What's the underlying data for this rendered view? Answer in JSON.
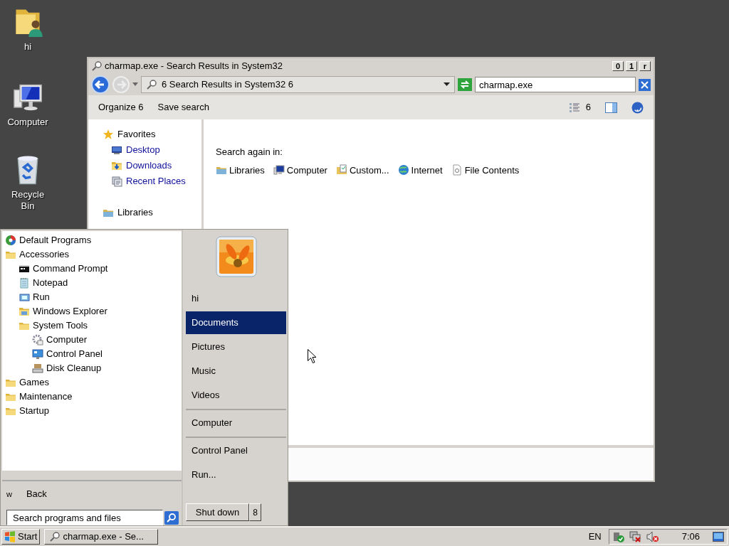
{
  "desktop_icons": [
    {
      "label": "hi",
      "kind": "user-folder"
    },
    {
      "label": "Computer",
      "kind": "computer"
    },
    {
      "label": "Recycle Bin",
      "kind": "recycle-bin"
    }
  ],
  "window": {
    "title": "charmap.exe - Search Results in System32",
    "title_buttons": [
      "0",
      "1",
      "r"
    ],
    "address": "6 Search Results in System32 6",
    "search_value": "charmap.exe",
    "toolbar": {
      "buttons": [
        "Organize 6",
        "Save search"
      ],
      "view_button": "6"
    },
    "nav": [
      {
        "label": "Favorites",
        "kind": "star",
        "children": [
          {
            "label": "Desktop",
            "kind": "desktop"
          },
          {
            "label": "Downloads",
            "kind": "downloads"
          },
          {
            "label": "Recent Places",
            "kind": "recent"
          }
        ]
      },
      {
        "label": "Libraries",
        "kind": "library"
      }
    ],
    "content": {
      "heading": "Search again in:",
      "locations": [
        {
          "label": "Libraries",
          "kind": "library"
        },
        {
          "label": "Computer",
          "kind": "computer"
        },
        {
          "label": "Custom...",
          "kind": "custom"
        },
        {
          "label": "Internet",
          "kind": "internet"
        },
        {
          "label": "File Contents",
          "kind": "file"
        }
      ]
    }
  },
  "start_menu": {
    "programs": [
      {
        "label": "Default Programs",
        "kind": "program"
      },
      {
        "label": "Accessories",
        "kind": "folder",
        "children": [
          {
            "label": "Command Prompt",
            "kind": "cmd"
          },
          {
            "label": "Notepad",
            "kind": "notepad"
          },
          {
            "label": "Run",
            "kind": "run"
          },
          {
            "label": "Windows Explorer",
            "kind": "explorer"
          },
          {
            "label": "System Tools",
            "kind": "folder",
            "children": [
              {
                "label": "Computer",
                "kind": "gear"
              },
              {
                "label": "Control Panel",
                "kind": "control"
              },
              {
                "label": "Disk Cleanup",
                "kind": "disk"
              }
            ]
          }
        ]
      },
      {
        "label": "Games",
        "kind": "folder"
      },
      {
        "label": "Maintenance",
        "kind": "folder"
      },
      {
        "label": "Startup",
        "kind": "folder"
      }
    ],
    "back": {
      "glyph": "w",
      "label": "Back"
    },
    "search_placeholder": "Search programs and files",
    "place_groups": [
      {
        "items": [
          {
            "label": "hi",
            "selected": false
          },
          {
            "label": "Documents",
            "selected": true
          },
          {
            "label": "Pictures",
            "selected": false
          },
          {
            "label": "Music",
            "selected": false
          },
          {
            "label": "Videos",
            "selected": false
          }
        ]
      },
      {
        "items": [
          {
            "label": "Computer",
            "selected": false
          }
        ]
      },
      {
        "items": [
          {
            "label": "Control Panel",
            "selected": false
          },
          {
            "label": "Run...",
            "selected": false
          }
        ]
      }
    ],
    "shutdown": "Shut down",
    "shutdown_arrow": "8"
  },
  "taskbar": {
    "start": "Start",
    "tasks": [
      {
        "label": "charmap.exe - Se...",
        "selected": false
      }
    ],
    "language": "EN",
    "clock": "7:06"
  }
}
